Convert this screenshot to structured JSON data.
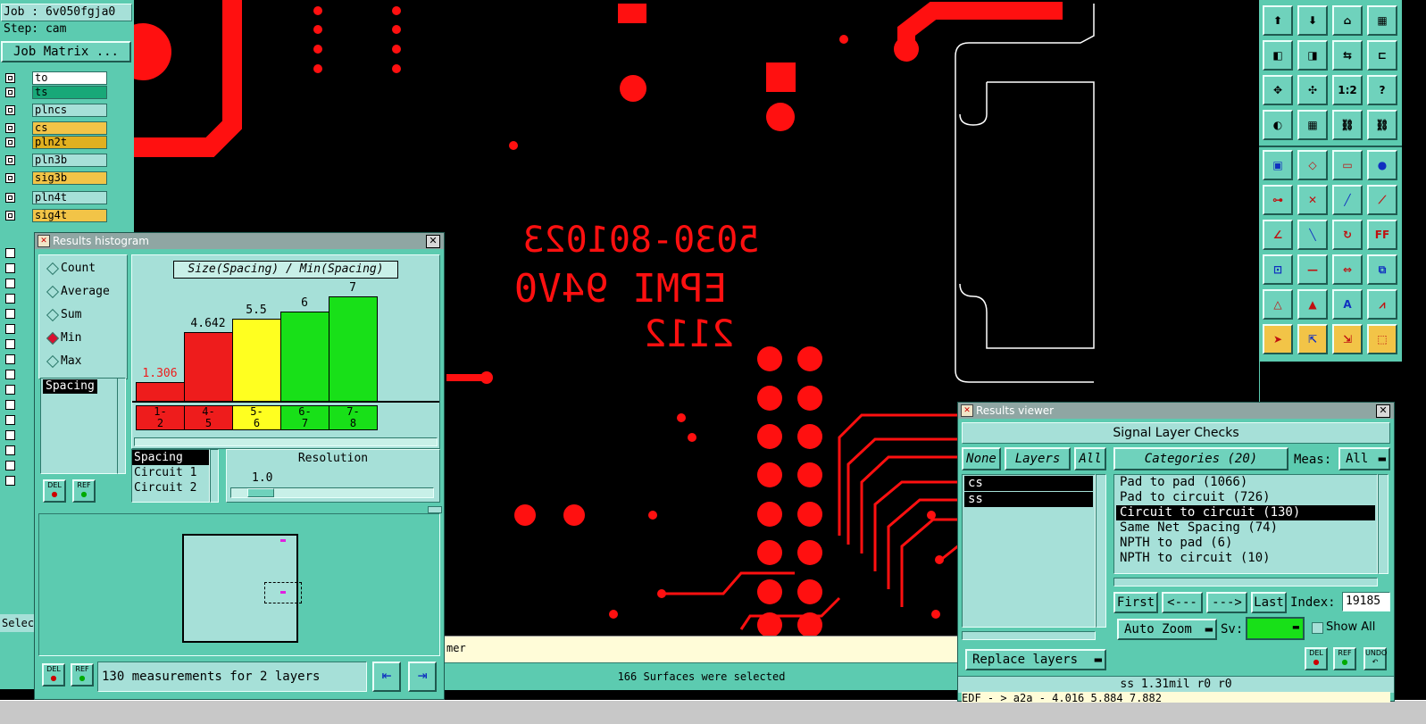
{
  "job_panel": {
    "job": "Job : 6v050fgja0",
    "step": "Step: cam",
    "matrix_button": "Job Matrix ..."
  },
  "layers": [
    {
      "name": "to",
      "color": "#ffffff"
    },
    {
      "name": "ts",
      "color": "#18a878"
    },
    {
      "name": "plncs",
      "color": "#a6e0d8"
    },
    {
      "name": "cs",
      "color": "#f2c447"
    },
    {
      "name": "pln2t",
      "color": "#e0b020"
    },
    {
      "name": "pln3b",
      "color": "#a6e0d8"
    },
    {
      "name": "sig3b",
      "color": "#f2c447"
    },
    {
      "name": "pln4t",
      "color": "#a6e0d8"
    },
    {
      "name": "sig4t",
      "color": "#f2c447"
    }
  ],
  "left_status": "Selec",
  "board": {
    "silk_text_1": "5030-801023",
    "silk_text_2": "EPMI 94V0",
    "silk_text_3": "2112",
    "colors": {
      "copper": "#ff1010",
      "outline": "#ffffff",
      "background": "#000000"
    }
  },
  "histogram": {
    "title": "Results histogram",
    "modes": [
      {
        "label": "Count",
        "selected": false
      },
      {
        "label": "Average",
        "selected": false
      },
      {
        "label": "Sum",
        "selected": false
      },
      {
        "label": "Min",
        "selected": true
      },
      {
        "label": "Max",
        "selected": false
      }
    ],
    "measure_list": [
      "Spacing"
    ],
    "chart_title": "Size(Spacing) / Min(Spacing)",
    "bars": [
      {
        "value": "1.306",
        "num": 1.306,
        "range": "1-\n2",
        "color": "#ee1c1c",
        "label_color": "#ee1c1c"
      },
      {
        "value": "4.642",
        "num": 4.642,
        "range": "4-\n5",
        "color": "#ee1c1c",
        "label_color": "#000000"
      },
      {
        "value": "5.5",
        "num": 5.5,
        "range": "5-\n6",
        "color": "#ffff20",
        "label_color": "#000000"
      },
      {
        "value": "6",
        "num": 6,
        "range": "6-\n7",
        "color": "#18e018",
        "label_color": "#000000"
      },
      {
        "value": "7",
        "num": 7,
        "range": "7-\n8",
        "color": "#18e018",
        "label_color": "#000000"
      }
    ],
    "y_max": 7,
    "type_list": [
      "Spacing",
      "Circuit 1",
      "Circuit 2"
    ],
    "resolution_label": "Resolution",
    "resolution_value": "1.0",
    "del_label": "DEL",
    "ref_label": "REF",
    "status": "130 measurements for 2 layers"
  },
  "message_bar": {
    "left_text": "mer",
    "status": "166 Surfaces were selected"
  },
  "results_viewer": {
    "title": "Results viewer",
    "heading": "Signal Layer Checks",
    "none_label": "None",
    "layers_label": "Layers",
    "all_label": "All",
    "categories_label": "Categories (20)",
    "meas_label": "Meas:",
    "meas_value": "All",
    "layer_items": [
      "cs",
      "ss"
    ],
    "categories": [
      {
        "label": "Pad to pad (1066)",
        "selected": false
      },
      {
        "label": "Pad to circuit (726)",
        "selected": false
      },
      {
        "label": "Circuit to circuit (130)",
        "selected": true
      },
      {
        "label": "Same Net Spacing (74)",
        "selected": false
      },
      {
        "label": "NPTH to pad (6)",
        "selected": false
      },
      {
        "label": "NPTH to circuit (10)",
        "selected": false
      }
    ],
    "first_label": "First",
    "prev_label": "<---",
    "next_label": "--->",
    "last_label": "Last",
    "index_label": "Index:",
    "index_value": "19185",
    "auto_zoom": "Auto Zoom",
    "sv_label": "Sv:",
    "show_all": "Show All",
    "replace_layers": "Replace layers",
    "del_label": "DEL",
    "ref_label": "REF",
    "undo_label": "UNDO",
    "measurement": "ss 1.31mil  r0  r0",
    "coords": "EDF - > a2a - 4.016 5.884 7.882"
  },
  "toolbar_top": [
    {
      "icon": "load-icon",
      "glyph": "⬆"
    },
    {
      "icon": "save-icon",
      "glyph": "⬇"
    },
    {
      "icon": "home-icon",
      "glyph": "⌂"
    },
    {
      "icon": "windows-icon",
      "glyph": "▦"
    },
    {
      "icon": "left-icon",
      "glyph": "◧"
    },
    {
      "icon": "right-icon",
      "glyph": "◨"
    },
    {
      "icon": "swap-icon",
      "glyph": "⇆"
    },
    {
      "icon": "extend-icon",
      "glyph": "⊏"
    },
    {
      "icon": "zoom-fit-icon",
      "glyph": "✥"
    },
    {
      "icon": "zoom-box-icon",
      "glyph": "✣"
    },
    {
      "icon": "scale-icon",
      "glyph": "1:2"
    },
    {
      "icon": "help-icon",
      "glyph": "?"
    },
    {
      "icon": "palette-icon",
      "glyph": "◐"
    },
    {
      "icon": "grid-icon",
      "glyph": "▦"
    },
    {
      "icon": "net-icon",
      "glyph": "⛓"
    },
    {
      "icon": "net-red-icon",
      "glyph": "⛓"
    }
  ],
  "toolbar_tools": [
    {
      "icon": "pad-icon",
      "glyph": "▣"
    },
    {
      "icon": "shape-icon",
      "glyph": "◇"
    },
    {
      "icon": "ruler-icon",
      "glyph": "▭"
    },
    {
      "icon": "dot-icon",
      "glyph": "●"
    },
    {
      "icon": "connect-icon",
      "glyph": "⊶"
    },
    {
      "icon": "cross-icon",
      "glyph": "✕"
    },
    {
      "icon": "line-icon",
      "glyph": "╱"
    },
    {
      "icon": "line-pad-icon",
      "glyph": "⟋"
    },
    {
      "icon": "angle-icon",
      "glyph": "∠"
    },
    {
      "icon": "diagonal-icon",
      "glyph": "╲"
    },
    {
      "icon": "rotate-icon",
      "glyph": "↻"
    },
    {
      "icon": "ff-icon",
      "glyph": "FF"
    },
    {
      "icon": "pad-move-icon",
      "glyph": "⊡"
    },
    {
      "icon": "minus-icon",
      "glyph": "—"
    },
    {
      "icon": "measure-icon",
      "glyph": "⇔"
    },
    {
      "icon": "group-icon",
      "glyph": "⧉"
    },
    {
      "icon": "tri-1-icon",
      "glyph": "△"
    },
    {
      "icon": "tri-2-icon",
      "glyph": "▲"
    },
    {
      "icon": "tri-3-icon",
      "glyph": "A"
    },
    {
      "icon": "tri-4-icon",
      "glyph": "⩘"
    },
    {
      "icon": "pointer-icon",
      "glyph": "➤"
    },
    {
      "icon": "pointer-box-icon",
      "glyph": "⇱"
    },
    {
      "icon": "pointer-sel-icon",
      "glyph": "⇲"
    },
    {
      "icon": "pointer-multi-icon",
      "glyph": "⬚"
    }
  ]
}
